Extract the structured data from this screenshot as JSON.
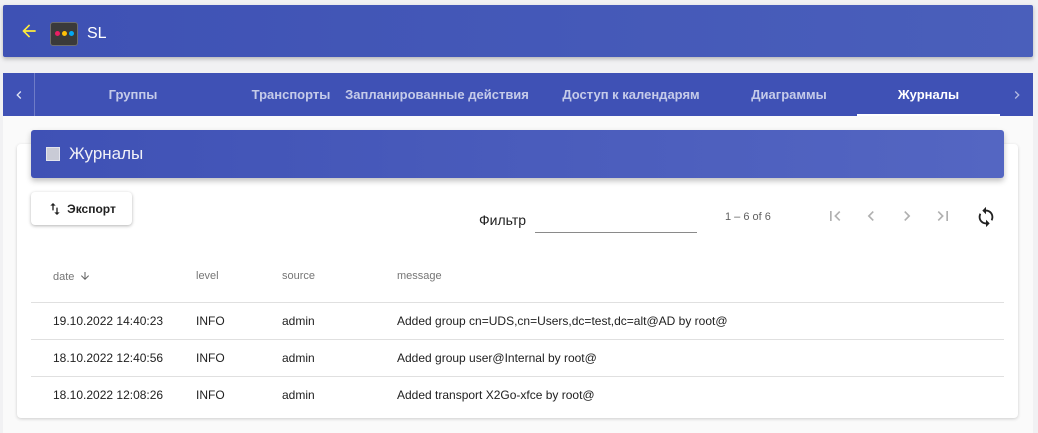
{
  "app": {
    "title": "SL"
  },
  "tabs": [
    {
      "label": "Группы"
    },
    {
      "label": "Транспорты"
    },
    {
      "label": "Запланированные действия"
    },
    {
      "label": "Доступ к календарям"
    },
    {
      "label": "Диаграммы"
    },
    {
      "label": "Журналы"
    }
  ],
  "active_tab": "Журналы",
  "panel": {
    "title": "Журналы"
  },
  "toolbar": {
    "export_label": "Экспорт",
    "filter_label": "Фильтр",
    "filter_value": ""
  },
  "paginator": {
    "range": "1 – 6 of 6"
  },
  "table": {
    "columns": [
      "date",
      "level",
      "source",
      "message"
    ],
    "sort_column": "date",
    "sort_direction": "desc",
    "rows": [
      {
        "date": "19.10.2022 14:40:23",
        "level": "INFO",
        "source": "admin",
        "message": "Added group cn=UDS,cn=Users,dc=test,dc=alt@AD by root@"
      },
      {
        "date": "18.10.2022 12:40:56",
        "level": "INFO",
        "source": "admin",
        "message": "Added group user@Internal by root@"
      },
      {
        "date": "18.10.2022 12:08:26",
        "level": "INFO",
        "source": "admin",
        "message": "Added transport X2Go-xfce by root@"
      }
    ]
  },
  "colors": {
    "primary": "#3f51b5",
    "back_arrow": "#ffeb3b"
  },
  "icons": {
    "back": "arrow-left-icon",
    "logo": "app-logo-icon",
    "tab_prev": "chevron-left-icon",
    "tab_next": "chevron-right-icon",
    "panel": "square-icon",
    "export": "sort-arrows-icon",
    "first_page": "first-page-icon",
    "prev_page": "chevron-left-icon",
    "next_page": "chevron-right-icon",
    "last_page": "last-page-icon",
    "refresh": "refresh-icon",
    "sort": "arrow-down-icon"
  }
}
